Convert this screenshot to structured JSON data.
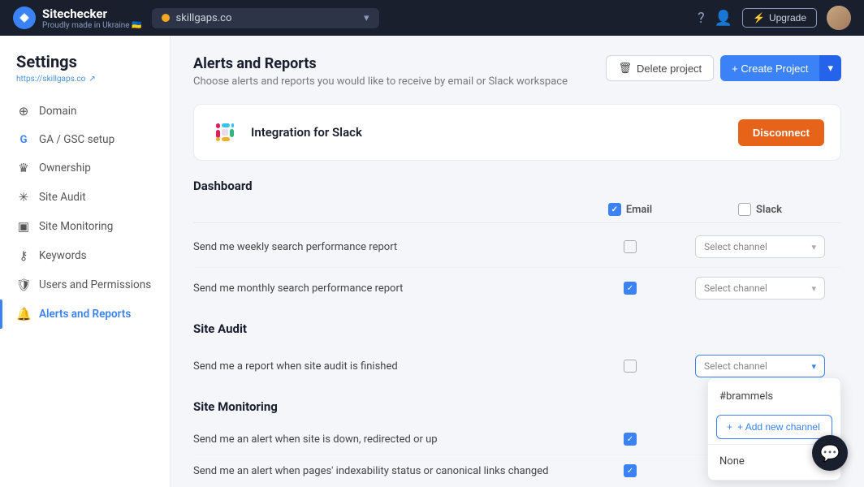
{
  "topnav": {
    "logo_text": "Sitechecker",
    "logo_sub": "Proudly made in Ukraine 🇺🇦",
    "url": "skillgaps.co",
    "upgrade_label": "Upgrade"
  },
  "header": {
    "title": "Settings",
    "url_link": "https://skillgaps.co",
    "delete_label": "Delete project",
    "create_label": "+ Create Project"
  },
  "sidebar": {
    "items": [
      {
        "id": "domain",
        "label": "Domain",
        "icon": "🌐"
      },
      {
        "id": "ga-gsc",
        "label": "GA / GSC setup",
        "icon": "G"
      },
      {
        "id": "ownership",
        "label": "Ownership",
        "icon": "👑"
      },
      {
        "id": "site-audit",
        "label": "Site Audit",
        "icon": "🕷"
      },
      {
        "id": "site-monitoring",
        "label": "Site Monitoring",
        "icon": "🖥"
      },
      {
        "id": "keywords",
        "label": "Keywords",
        "icon": "🔑"
      },
      {
        "id": "users-permissions",
        "label": "Users and Permissions",
        "icon": "🛡"
      },
      {
        "id": "alerts-reports",
        "label": "Alerts and Reports",
        "icon": "🔔",
        "active": true
      }
    ]
  },
  "page": {
    "title": "Alerts and Reports",
    "subtitle": "Choose alerts and reports you would like to receive by email or Slack workspace"
  },
  "slack": {
    "name": "Integration for Slack",
    "disconnect_label": "Disconnect"
  },
  "dashboard": {
    "section_title": "Dashboard",
    "col_email": "Email",
    "col_slack": "Slack",
    "rows": [
      {
        "label": "Send me weekly search performance report",
        "email_checked": false,
        "slack_dropdown": true,
        "channel_value": "Select channel"
      },
      {
        "label": "Send me monthly search performance report",
        "email_checked": true,
        "slack_dropdown": true,
        "channel_value": "Select channel"
      }
    ]
  },
  "site_audit": {
    "section_title": "Site Audit",
    "rows": [
      {
        "label": "Send me a report when site audit is finished",
        "email_checked": false,
        "slack_dropdown": true,
        "channel_value": "Select channel",
        "dropdown_open": true
      }
    ],
    "dropdown_options": [
      "#brammels"
    ],
    "add_channel_label": "+ Add new channel",
    "none_label": "None"
  },
  "site_monitoring": {
    "section_title": "Site Monitoring",
    "rows": [
      {
        "label": "Send me an alert when site is down, redirected or up",
        "email_checked": true
      },
      {
        "label": "Send me an alert when pages' indexability status or canonical links changed",
        "email_checked": true
      }
    ]
  },
  "chat": {
    "icon": "💬"
  }
}
